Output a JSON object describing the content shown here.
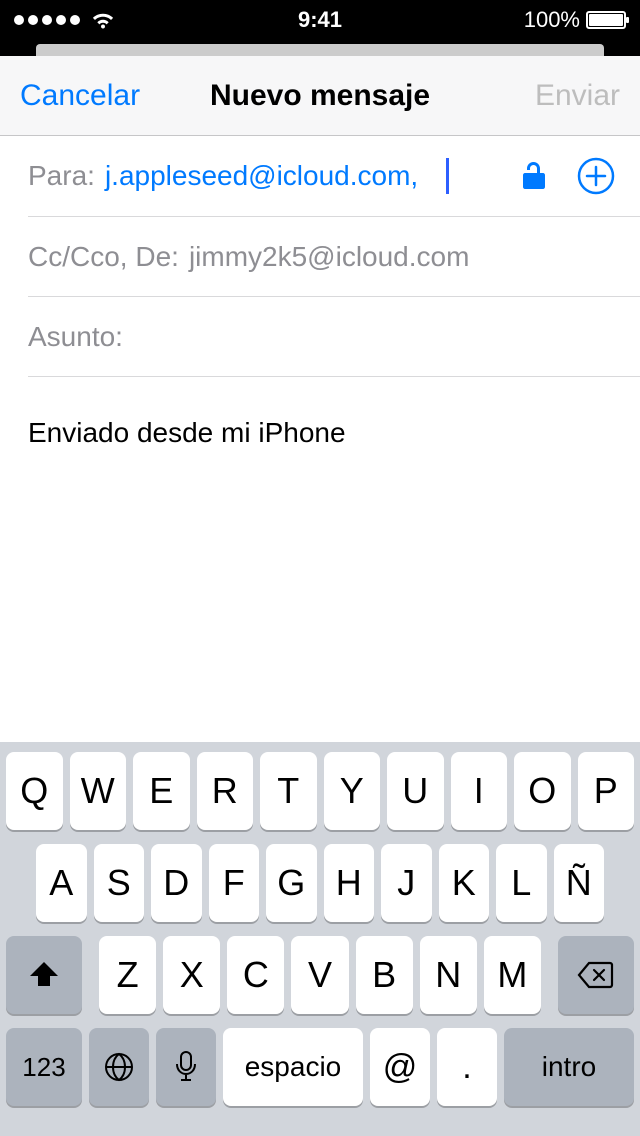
{
  "status": {
    "time": "9:41",
    "battery_pct": "100%"
  },
  "nav": {
    "cancel": "Cancelar",
    "title": "Nuevo mensaje",
    "send": "Enviar"
  },
  "compose": {
    "to_label": "Para:",
    "to_value": "j.appleseed@icloud.com,",
    "cc_label": "Cc/Cco, De:",
    "cc_value": "jimmy2k5@icloud.com",
    "subject_label": "Asunto:",
    "signature": "Enviado desde mi iPhone"
  },
  "keyboard": {
    "row1": [
      "Q",
      "W",
      "E",
      "R",
      "T",
      "Y",
      "U",
      "I",
      "O",
      "P"
    ],
    "row2": [
      "A",
      "S",
      "D",
      "F",
      "G",
      "H",
      "J",
      "K",
      "L",
      "Ñ"
    ],
    "row3": [
      "Z",
      "X",
      "C",
      "V",
      "B",
      "N",
      "M"
    ],
    "n123": "123",
    "space": "espacio",
    "at": "@",
    "dot": ".",
    "enter": "intro"
  }
}
